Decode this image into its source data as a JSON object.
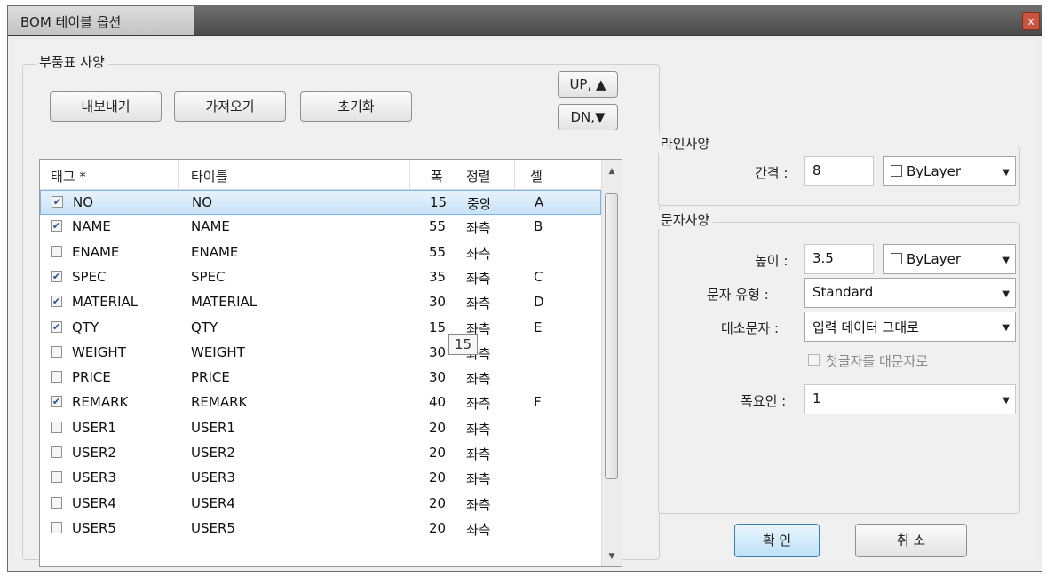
{
  "window": {
    "title": "BOM 테이블 옵션",
    "close_glyph": "x"
  },
  "bom_spec": {
    "legend": "부품표 사양",
    "buttons": {
      "export": "내보내기",
      "import": "가져오기",
      "reset": "초기화",
      "up": "UP, ▲",
      "down": "DN,▼"
    },
    "columns": {
      "tag": "태그 *",
      "title": "타이틀",
      "width": "폭",
      "align": "정렬",
      "cell": "셀"
    },
    "rows": [
      {
        "checked": true,
        "tag": "NO",
        "title": "NO",
        "width": "15",
        "align": "중앙",
        "cell": "A"
      },
      {
        "checked": true,
        "tag": "NAME",
        "title": "NAME",
        "width": "55",
        "align": "좌측",
        "cell": "B"
      },
      {
        "checked": false,
        "tag": "ENAME",
        "title": "ENAME",
        "width": "55",
        "align": "좌측",
        "cell": ""
      },
      {
        "checked": true,
        "tag": "SPEC",
        "title": "SPEC",
        "width": "35",
        "align": "좌측",
        "cell": "C"
      },
      {
        "checked": true,
        "tag": "MATERIAL",
        "title": "MATERIAL",
        "width": "30",
        "align": "좌측",
        "cell": "D"
      },
      {
        "checked": true,
        "tag": "QTY",
        "title": "QTY",
        "width": "15",
        "align": "좌측",
        "cell": "E"
      },
      {
        "checked": false,
        "tag": "WEIGHT",
        "title": "WEIGHT",
        "width": "30",
        "align": "좌측",
        "cell": ""
      },
      {
        "checked": false,
        "tag": "PRICE",
        "title": "PRICE",
        "width": "30",
        "align": "좌측",
        "cell": ""
      },
      {
        "checked": true,
        "tag": "REMARK",
        "title": "REMARK",
        "width": "40",
        "align": "좌측",
        "cell": "F"
      },
      {
        "checked": false,
        "tag": "USER1",
        "title": "USER1",
        "width": "20",
        "align": "좌측",
        "cell": ""
      },
      {
        "checked": false,
        "tag": "USER2",
        "title": "USER2",
        "width": "20",
        "align": "좌측",
        "cell": ""
      },
      {
        "checked": false,
        "tag": "USER3",
        "title": "USER3",
        "width": "20",
        "align": "좌측",
        "cell": ""
      },
      {
        "checked": false,
        "tag": "USER4",
        "title": "USER4",
        "width": "20",
        "align": "좌측",
        "cell": ""
      },
      {
        "checked": false,
        "tag": "USER5",
        "title": "USER5",
        "width": "20",
        "align": "좌측",
        "cell": ""
      }
    ],
    "tooltip": "15"
  },
  "line_spec": {
    "legend": "라인사양",
    "spacing_label": "간격 :",
    "spacing_value": "8",
    "color_value": "ByLayer"
  },
  "text_spec": {
    "legend": "문자사양",
    "height_label": "높이 :",
    "height_value": "3.5",
    "color_value": "ByLayer",
    "style_label": "문자 유형 :",
    "style_value": "Standard",
    "case_label": "대소문자 :",
    "case_value": "입력 데이터 그대로",
    "capitalize_first_label": "첫글자를 대문자로",
    "width_factor_label": "폭요인 :",
    "width_factor_value": "1"
  },
  "dialog_buttons": {
    "ok": "확 인",
    "cancel": "취 소"
  },
  "colors": {
    "selection": "#c9e2f7",
    "check": "#2a4f9b",
    "primary_button": "#bde1f7"
  }
}
